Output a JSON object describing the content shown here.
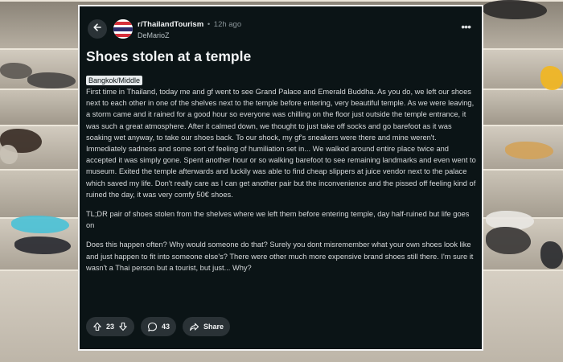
{
  "post": {
    "subreddit": "r/ThailandTourism",
    "separator": "•",
    "age": "12h ago",
    "author": "DeMarioZ",
    "title": "Shoes stolen at a temple",
    "flair": "Bangkok/Middle",
    "paragraphs": [
      "First time in Thailand, today me and gf went to see Grand Palace and Emerald Buddha. As you do, we left our shoes next to each other in one of the shelves next to the temple before entering, very beautiful temple. As we were leaving, a storm came and it rained for a good hour so everyone was chilling on the floor just outside the temple entrance, it was such a great atmosphere. After it calmed down, we thought to just take off socks and go barefoot as it was soaking wet anyway, to take our shoes back. To our shock, my gf's sneakers were there and mine weren't. Immediately sadness and some sort of feeling of humiliation set in... We walked around entire place twice and accepted it was simply gone. Spent another hour or so walking barefoot to see remaining landmarks and even went to museum. Exited the temple afterwards and luckily was able to find cheap slippers at juice vendor next to the palace which saved my life. Don't really care as I can get another pair but the inconvenience and the pissed off feeling kind of ruined the day, it was very comfy 50€ shoes.",
      "TL;DR pair of shoes stolen from the shelves where we left them before entering temple, day half-ruined but life goes on",
      "Does this happen often? Why would someone do that? Surely you dont misremember what your own shoes look like and just happen to fit into someone else's? There were other much more expensive brand shoes still there. I'm sure it wasn't a Thai person but a tourist, but just... Why?"
    ]
  },
  "actions": {
    "votes": "23",
    "comments": "43",
    "share_label": "Share"
  },
  "menu": {
    "more_label": "•••"
  },
  "icons": {
    "back": "arrow-left-icon",
    "avatar": "thai-flag-avatar",
    "upvote": "arrow-up-icon",
    "downvote": "arrow-down-icon",
    "comment": "comment-bubble-icon",
    "share": "share-arrow-icon",
    "more": "ellipsis-icon"
  },
  "colors": {
    "card_bg": "#0b1416",
    "text": "#d7dadc",
    "button_bg": "#2a3236",
    "flair_bg": "#e8ecee"
  }
}
